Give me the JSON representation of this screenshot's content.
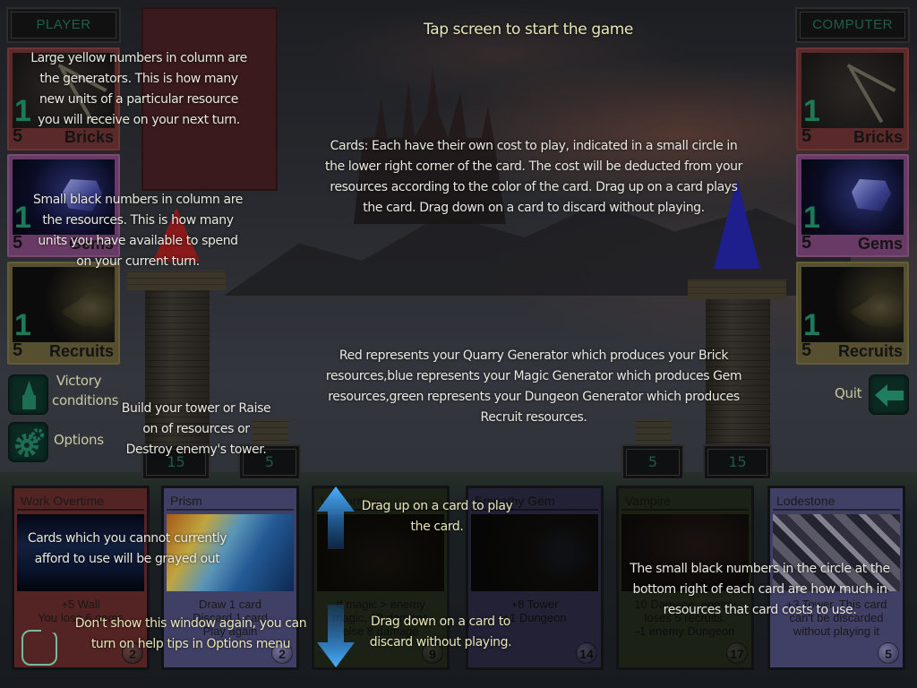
{
  "status": {
    "start_prompt": "Tap screen to start the game"
  },
  "player": {
    "label": "PLAYER",
    "resources": [
      {
        "name": "Bricks",
        "generator": "1",
        "amount": "5",
        "color": "#5a2a2a"
      },
      {
        "name": "Gems",
        "generator": "1",
        "amount": "5",
        "color": "#6a3a66"
      },
      {
        "name": "Recruits",
        "generator": "1",
        "amount": "5",
        "color": "#565030"
      }
    ],
    "tower_height": "15",
    "wall_height": "5",
    "tower_roof_color": "#9a1a1a"
  },
  "computer": {
    "label": "COMPUTER",
    "resources": [
      {
        "name": "Bricks",
        "generator": "1",
        "amount": "5",
        "color": "#5a2a2a"
      },
      {
        "name": "Gems",
        "generator": "1",
        "amount": "5",
        "color": "#6a3a66"
      },
      {
        "name": "Recruits",
        "generator": "1",
        "amount": "5",
        "color": "#565030"
      }
    ],
    "tower_height": "15",
    "wall_height": "5",
    "tower_roof_color": "#1a1a8a"
  },
  "menu": {
    "victory_label": "Victory conditions",
    "victory_line1": "Victory",
    "victory_line2": "conditions",
    "options_label": "Options",
    "quit_label": "Quit"
  },
  "hand": [
    {
      "title": "Work Overtime",
      "color": "red",
      "text": "+5 Wall\nYou lose 6 gems",
      "text_line1": "+5 Wall",
      "text_line2": "You lose 6 gems",
      "text_line3": "",
      "cost": "2",
      "grayed": false
    },
    {
      "title": "Prism",
      "color": "blue",
      "text_line1": "Draw 1 card",
      "text_line2": "Discard 1 card",
      "text_line3": "Play again",
      "cost": "2",
      "grayed": false
    },
    {
      "title": "Unicorn",
      "color": "blue",
      "text_line1": "If magic > enemy",
      "text_line2": "magic, 12 damage",
      "text_line3": "else 8 damage",
      "cost": "9",
      "grayed": true
    },
    {
      "title": "Empathy Gem",
      "color": "blue",
      "text_line1": "+8 Tower",
      "text_line2": "+1 Dungeon",
      "text_line3": "",
      "cost": "14",
      "grayed": true
    },
    {
      "title": "Vampire",
      "color": "green",
      "text_line1": "10 Damage, enemy",
      "text_line2": "loses 5 recruits.",
      "text_line3": "-1 enemy Dungeon",
      "cost": "17",
      "grayed": true
    },
    {
      "title": "Lodestone",
      "color": "blue",
      "text_line1": "+3 Tower. This card",
      "text_line2": "can't be discarded",
      "text_line3": "without playing it",
      "cost": "5",
      "grayed": false
    }
  ],
  "tips": {
    "generators": "Large yellow numbers in column are the generators. This is how many new units of a particular resource you will receive on your next turn.",
    "resources": "Small black numbers in column are the resources. This is how many units you have available to spend on your current turn.",
    "cards": "Cards: Each have their own cost to play, indicated in a small circle in the lower right corner of the card. The cost will be deducted from your resources according to the color of the card. Drag up on a card plays the card. Drag down on a card to discard without playing.",
    "colors": "Red represents your Quarry Generator which produces your Brick resources,blue represents your Magic Generator which produces Gem resources,green represents your Dungeon Generator which produces Recruit resources.",
    "goal": "Build your tower or Raise on of resources or Destroy enemy's tower.",
    "grayed": "Cards which you cannot currently afford to use will be grayed out",
    "drag_up": "Drag up on a card to play the card.",
    "drag_down": "Drag down on a card to discard without playing.",
    "cost_circle": "The small black numbers in the circle at the bottom right of each card are how much in resources that card costs to use.",
    "dont_show": "Don't show this window again, you can turn on help tips in Options menu"
  },
  "icons": {
    "victory": "tower-icon",
    "options": "gear-icon",
    "quit": "arrow-left-icon",
    "drag_up": "arrow-up-icon",
    "drag_down": "arrow-down-icon"
  },
  "colors": {
    "accent_green": "#1a7a5a",
    "tip_text": "#e8e8e0",
    "label_yellow": "#c8c9a0",
    "arrow_blue": "#2a8ee8"
  }
}
